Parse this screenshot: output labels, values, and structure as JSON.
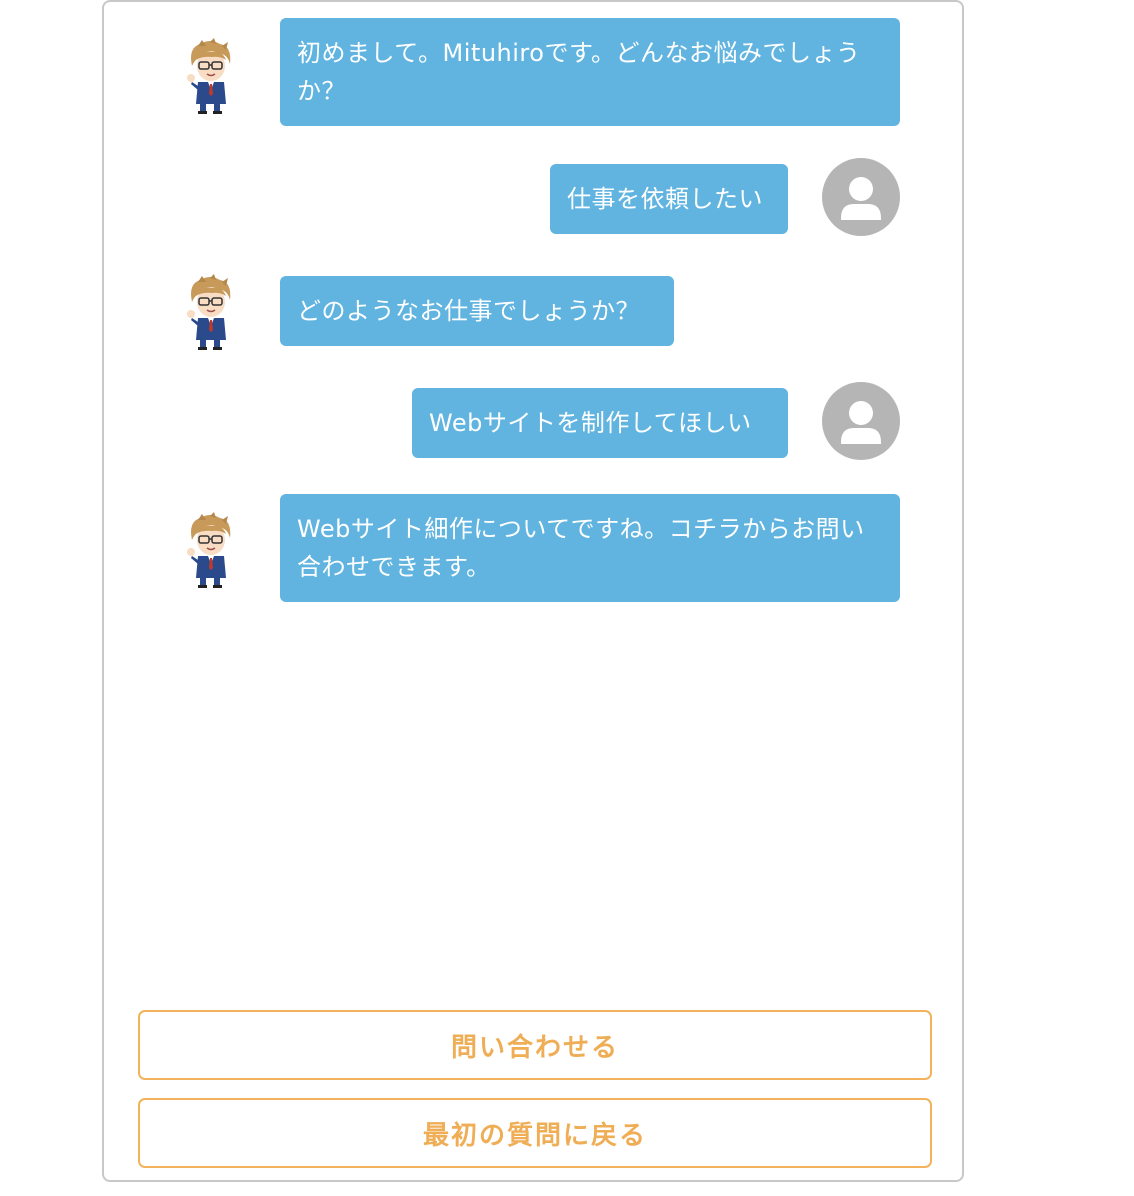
{
  "chat": {
    "messages": [
      {
        "sender": "bot",
        "text": "初めまして。Mituhiroです。どんなお悩みでしょうか？"
      },
      {
        "sender": "user",
        "text": "仕事を依頼したい"
      },
      {
        "sender": "bot",
        "text": "どのようなお仕事でしょうか？"
      },
      {
        "sender": "user",
        "text": "Webサイトを制作してほしい"
      },
      {
        "sender": "bot",
        "text": "Webサイト細作についてですね。コチラからお問い合わせできます。"
      }
    ]
  },
  "actions": {
    "inquiry_label": "問い合わせる",
    "back_label": "最初の質問に戻る"
  },
  "colors": {
    "bubble": "#61b4e0",
    "button_accent": "#efad55",
    "user_avatar": "#b5b5b5",
    "frame_border": "#c8c8c8"
  },
  "icons": {
    "bot_avatar": "anime-businessman-avatar-icon",
    "user_avatar": "default-user-silhouette-icon"
  }
}
